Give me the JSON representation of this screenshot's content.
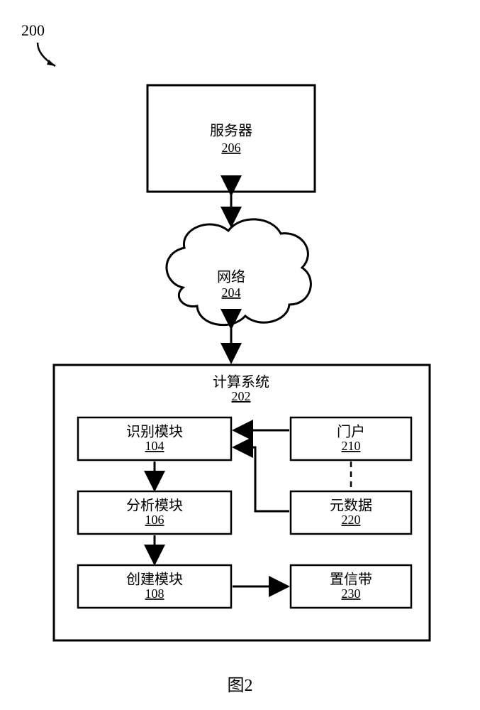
{
  "page_number": "200",
  "server": {
    "label": "服务器",
    "ref": "206"
  },
  "network": {
    "label": "网络",
    "ref": "204"
  },
  "computing_system": {
    "label": "计算系统",
    "ref": "202"
  },
  "modules": {
    "identify": {
      "label": "识别模块",
      "ref": "104"
    },
    "analyze": {
      "label": "分析模块",
      "ref": "106"
    },
    "create": {
      "label": "创建模块",
      "ref": "108"
    },
    "portal": {
      "label": "门户",
      "ref": "210"
    },
    "metadata": {
      "label": "元数据",
      "ref": "220"
    },
    "confidence": {
      "label": "置信带",
      "ref": "230"
    }
  },
  "figure_label": "图2"
}
